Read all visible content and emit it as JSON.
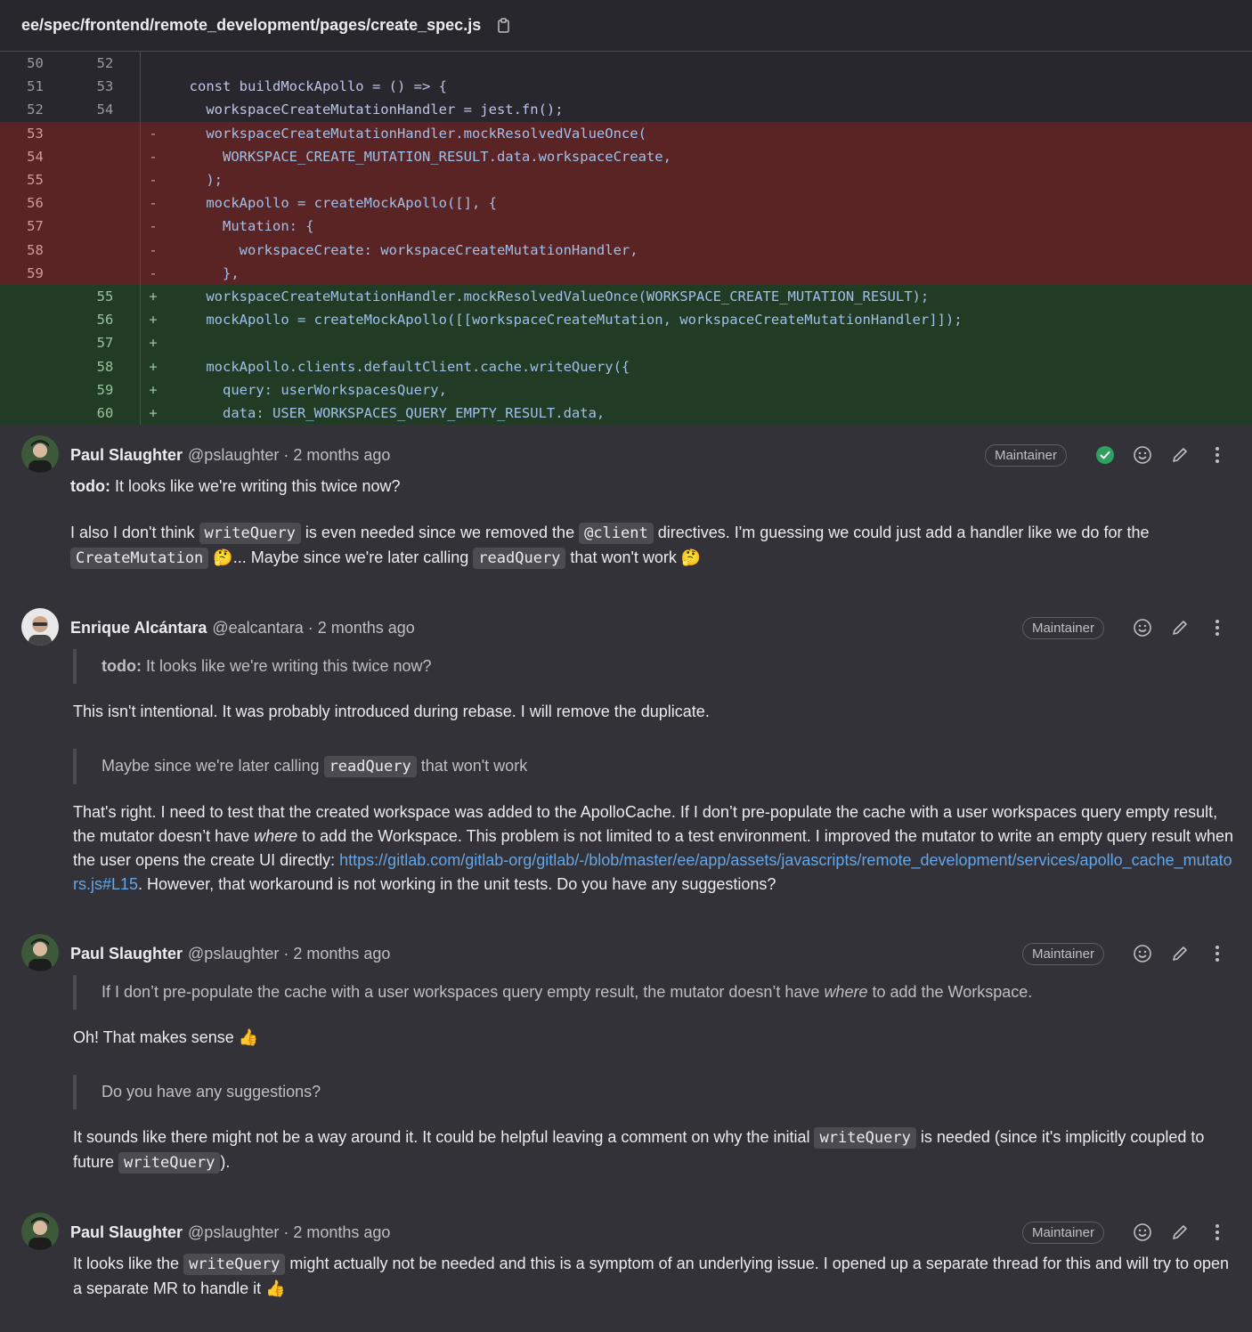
{
  "file_path": "ee/spec/frontend/remote_development/pages/create_spec.js",
  "diff_lines": [
    {
      "type": "ctx",
      "old": "50",
      "new": "52",
      "sign": "",
      "code": ""
    },
    {
      "type": "ctx",
      "old": "51",
      "new": "53",
      "sign": "",
      "code": "  const buildMockApollo = () => {"
    },
    {
      "type": "ctx",
      "old": "52",
      "new": "54",
      "sign": "",
      "code": "    workspaceCreateMutationHandler = jest.fn();"
    },
    {
      "type": "del",
      "old": "53",
      "new": "",
      "sign": "-",
      "code": "    workspaceCreateMutationHandler.mockResolvedValueOnce("
    },
    {
      "type": "del",
      "old": "54",
      "new": "",
      "sign": "-",
      "code": "      WORKSPACE_CREATE_MUTATION_RESULT.data.workspaceCreate,"
    },
    {
      "type": "del",
      "old": "55",
      "new": "",
      "sign": "-",
      "code": "    );"
    },
    {
      "type": "del",
      "old": "56",
      "new": "",
      "sign": "-",
      "code": "    mockApollo = createMockApollo([], {"
    },
    {
      "type": "del",
      "old": "57",
      "new": "",
      "sign": "-",
      "code": "      Mutation: {"
    },
    {
      "type": "del",
      "old": "58",
      "new": "",
      "sign": "-",
      "code": "        workspaceCreate: workspaceCreateMutationHandler,"
    },
    {
      "type": "del",
      "old": "59",
      "new": "",
      "sign": "-",
      "code": "      },"
    },
    {
      "type": "add",
      "old": "",
      "new": "55",
      "sign": "+",
      "code": "    workspaceCreateMutationHandler.mockResolvedValueOnce(WORKSPACE_CREATE_MUTATION_RESULT);"
    },
    {
      "type": "add",
      "old": "",
      "new": "56",
      "sign": "+",
      "code": "    mockApollo = createMockApollo([[workspaceCreateMutation, workspaceCreateMutationHandler]]);"
    },
    {
      "type": "add",
      "old": "",
      "new": "57",
      "sign": "+",
      "code": ""
    },
    {
      "type": "add",
      "old": "",
      "new": "58",
      "sign": "+",
      "code": "    mockApollo.clients.defaultClient.cache.writeQuery({"
    },
    {
      "type": "add",
      "old": "",
      "new": "59",
      "sign": "+",
      "code": "      query: userWorkspacesQuery,"
    },
    {
      "type": "add",
      "old": "",
      "new": "60",
      "sign": "+",
      "code": "      data: USER_WORKSPACES_QUERY_EMPTY_RESULT.data,"
    }
  ],
  "notes": [
    {
      "author": "Paul Slaughter",
      "handle": "@pslaughter · 2 months ago",
      "badge": "Maintainer",
      "resolved": true,
      "p1_todo": "todo:",
      "p1_text": " It looks like we're writing this twice now?",
      "p2_a": "I also I don't think ",
      "p2_code1": "writeQuery",
      "p2_b": " is even needed since we removed the ",
      "p2_code2": "@client",
      "p2_c": " directives. I'm guessing we could just add a handler like we do for the ",
      "p2_code3": "CreateMutation",
      "p2_emoji1": "🤔",
      "p2_d": "... Maybe since we're later calling ",
      "p2_code4": "readQuery",
      "p2_e": " that won't work ",
      "p2_emoji2": "🤔"
    },
    {
      "author": "Enrique Alcántara",
      "handle": "@ealcantara · 2 months ago",
      "badge": "Maintainer",
      "q1_todo": "todo:",
      "q1_text": " It looks like we're writing this twice now?",
      "p1": "This isn't intentional. It was probably introduced during rebase. I will remove the duplicate.",
      "q2_a": "Maybe since we're later calling ",
      "q2_code": "readQuery",
      "q2_b": " that won't work",
      "p2_a": "That's right. I need to test that the created workspace was added to the ApolloCache. If I don’t pre-populate the cache with a user workspaces query empty result, the mutator doesn’t have ",
      "p2_em": "where",
      "p2_b": " to add the Workspace. This problem is not limited to a test environment. I improved the mutator to write an empty query result when the user opens the create UI directly: ",
      "p2_link": "https://gitlab.com/gitlab-org/gitlab/-/blob/master/ee/app/assets/javascripts/remote_development/services/apollo_cache_mutators.js#L15",
      "p2_c": ". However, that workaround is not working in the unit tests. Do you have any suggestions?"
    },
    {
      "author": "Paul Slaughter",
      "handle": "@pslaughter · 2 months ago",
      "badge": "Maintainer",
      "q1_a": "If I don’t pre-populate the cache with a user workspaces query empty result, the mutator doesn’t have ",
      "q1_em": "where",
      "q1_b": " to add the Workspace.",
      "p1": "Oh! That makes sense ",
      "p1_emoji": "👍",
      "q2": "Do you have any suggestions?",
      "p2_a": "It sounds like there might not be a way around it. It could be helpful leaving a comment on why the initial ",
      "p2_code1": "writeQuery",
      "p2_b": " is needed (since it's implicitly coupled to future ",
      "p2_code2": "writeQuery",
      "p2_c": ")."
    },
    {
      "author": "Paul Slaughter",
      "handle": "@pslaughter · 2 months ago",
      "badge": "Maintainer",
      "p1_a": "It looks like the ",
      "p1_code": "writeQuery",
      "p1_b": " might actually not be needed and this is a symptom of an underlying issue. I opened up a separate thread for this and will try to open a separate MR to handle it ",
      "p1_emoji": "👍"
    }
  ],
  "colors": {
    "resolved": "#2da160",
    "link": "#63a6e9"
  }
}
